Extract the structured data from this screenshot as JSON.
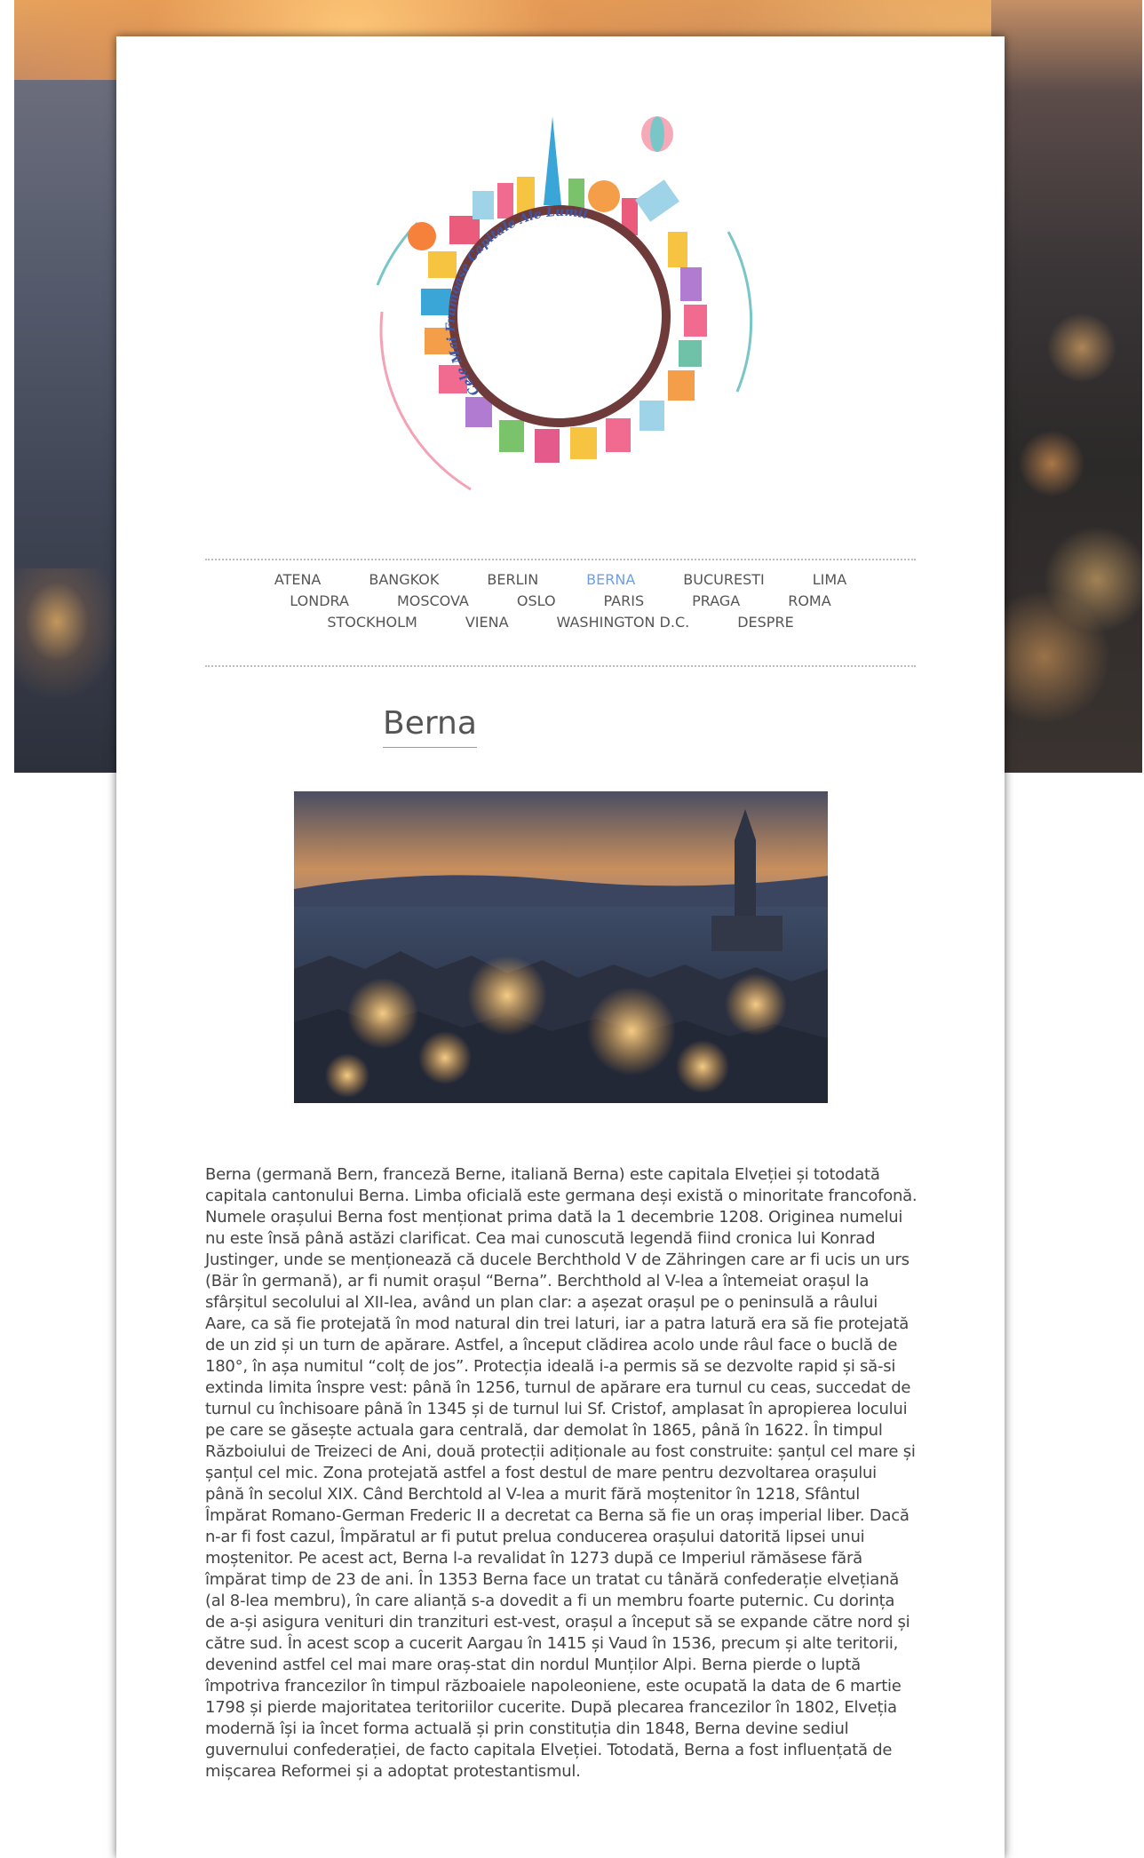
{
  "site": {
    "logo_text": "Cele Mai Frumoase Capitale Ale Lumii"
  },
  "nav": {
    "row1": [
      {
        "label": "ATENA",
        "active": false
      },
      {
        "label": "BANGKOK",
        "active": false
      },
      {
        "label": "BERLIN",
        "active": false
      },
      {
        "label": "BERNA",
        "active": true
      },
      {
        "label": "BUCURESTI",
        "active": false
      },
      {
        "label": "LIMA",
        "active": false
      }
    ],
    "row2": [
      {
        "label": "LONDRA",
        "active": false
      },
      {
        "label": "MOSCOVA",
        "active": false
      },
      {
        "label": "OSLO",
        "active": false
      },
      {
        "label": "PARIS",
        "active": false
      },
      {
        "label": "PRAGA",
        "active": false
      },
      {
        "label": "ROMA",
        "active": false
      }
    ],
    "row3": [
      {
        "label": "STOCKHOLM",
        "active": false
      },
      {
        "label": "VIENA",
        "active": false
      },
      {
        "label": "WASHINGTON D.C.",
        "active": false
      },
      {
        "label": "DESPRE",
        "active": false
      }
    ],
    "active_color": "#6d9fe6",
    "link_color": "#555555"
  },
  "article": {
    "title": "Berna",
    "body": "Berna (germană Bern, franceză Berne, italiană Berna) este capitala Elveției și totodată capitala cantonului Berna. Limba oficială este germana deși există o minoritate francofonă. Numele orașului Berna fost menționat prima dată la 1 decembrie 1208. Originea numelui nu este însă până astăzi clarificat. Cea mai cunoscută legendă fiind cronica lui Konrad Justinger, unde se menționează că ducele Berchthold V de Zähringen care ar fi ucis un urs (Bär în germană), ar fi numit orașul “Berna”. Berchthold al V-lea a întemeiat orașul la sfârșitul secolului al XII-lea, având un plan clar: a așezat orașul pe o peninsulă a râului Aare, ca să fie protejată în mod natural din trei laturi, iar a patra latură era să fie protejată de un zid și un turn de apărare. Astfel, a început clădirea acolo unde râul face o buclă de 180°, în așa numitul “colț de jos”. Protecția ideală i-a permis să se dezvolte rapid și să-si extinda limita înspre vest: până în 1256, turnul de apărare era turnul cu ceas, succedat de turnul cu închisoare până în 1345 și de turnul lui Sf. Cristof, amplasat în apropierea locului pe care se găsește actuala gara centrală, dar demolat în 1865, până în 1622. În timpul Războiului de Treizeci de Ani, două protecții adiționale au fost construite: șanțul cel mare și șanțul cel mic. Zona protejată astfel a fost destul de mare pentru dezvoltarea orașului până în secolul XIX. Când Berchtold al V-lea a murit fără moștenitor în 1218, Sfântul Împărat Romano-German Frederic II a decretat ca Berna să fie un oraș imperial liber. Dacă n-ar fi fost cazul, Împăratul ar fi putut prelua conducerea orașului datorită lipsei unui moștenitor. Pe acest act, Berna l-a revalidat în 1273 după ce Imperiul rămăsese fără împărat timp de 23 de ani. În 1353 Berna face un tratat cu tânără confederație elvețiană (al 8-lea membru), în care alianță s-a dovedit a fi un membru foarte puternic. Cu dorința de a-și asigura venituri din tranzituri est-vest, orașul a început să se expande către nord și către sud. În acest scop a cucerit Aargau în 1415 și Vaud în 1536, precum și alte teritorii, devenind astfel cel mai mare oraș-stat din nordul Munților Alpi. Berna pierde o luptă împotriva francezilor în timpul războaiele napoleoniene, este ocupată la data de 6 martie 1798 și pierde majoritatea teritoriilor cucerite. După plecarea francezilor în 1802, Elveția modernă își ia încet forma actuală și prin constituția din 1848, Berna devine sediul guvernului confederației, de facto capitala Elveției. Totodată, Berna a fost influențată de mișcarea Reformei și a adoptat protestantismul."
  }
}
